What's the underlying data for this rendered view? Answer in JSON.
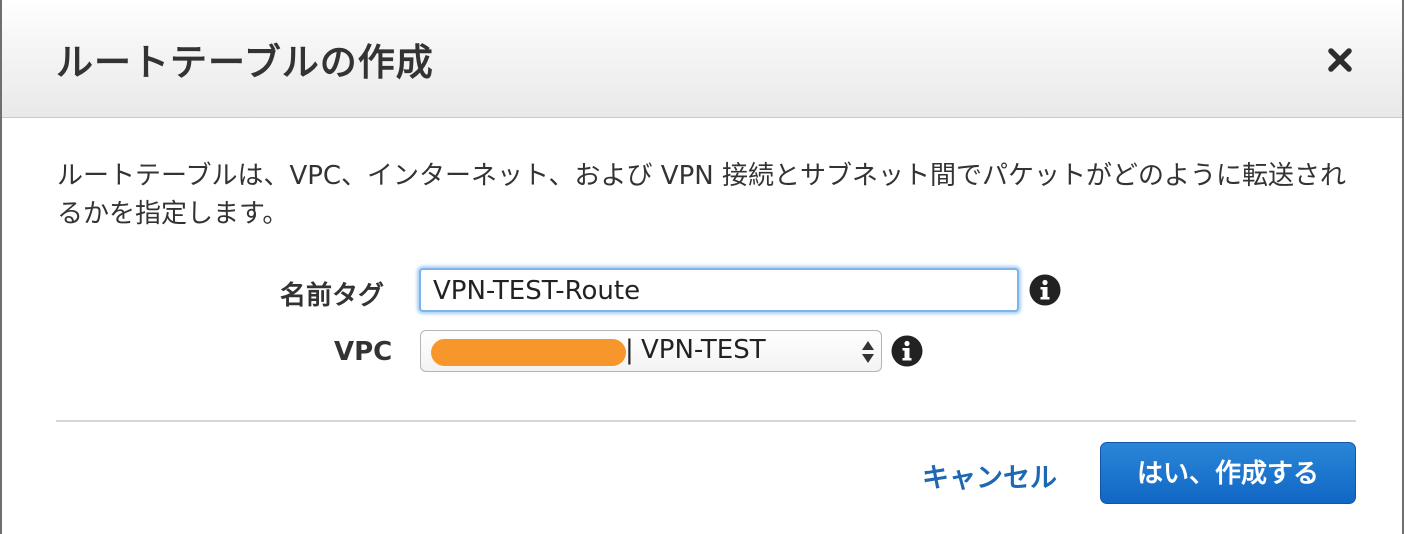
{
  "dialog": {
    "title": "ルートテーブルの作成",
    "description": "ルートテーブルは、VPC、インターネット、および VPN 接続とサブネット間でパケットがどのように転送されるかを指定します。"
  },
  "form": {
    "name_tag": {
      "label": "名前タグ",
      "value": "VPN-TEST-Route"
    },
    "vpc": {
      "label": "VPC",
      "separator": "|",
      "value": "VPN-TEST"
    }
  },
  "footer": {
    "cancel_label": "キャンセル",
    "confirm_label": "はい、作成する"
  },
  "colors": {
    "link": "#1e67b3",
    "primary_button": "#1167c4",
    "redaction": "#f7962a",
    "focus_ring": "#7fb4e8"
  },
  "icons": {
    "close": "close-icon",
    "info": "info-icon",
    "select_arrows": "updown-arrows-icon"
  }
}
